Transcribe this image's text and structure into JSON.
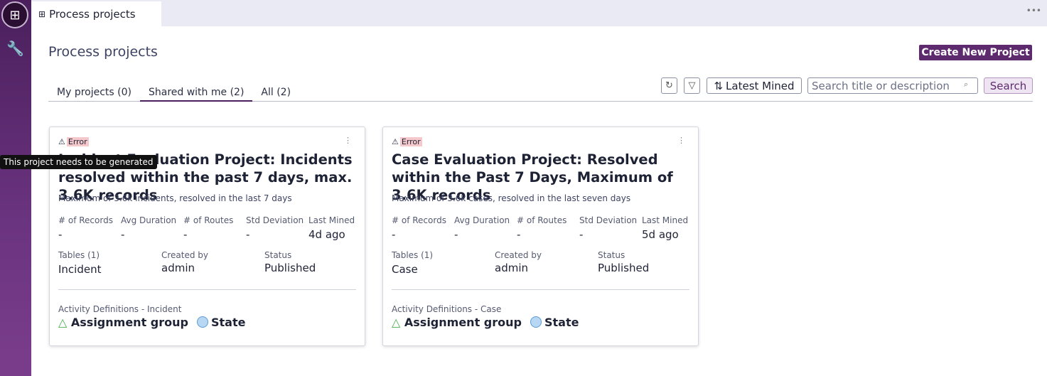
{
  "app": {
    "tab_label": "Process projects",
    "page_title": "Process projects",
    "create_label": "Create New Project"
  },
  "tabs": [
    "My projects (0)",
    "Shared with me (2)",
    "All (2)"
  ],
  "toolbar": {
    "sort_label": "Latest Mined",
    "search_placeholder": "Search title or description",
    "search_label": "Search"
  },
  "tooltip": "This project needs to be generated",
  "labels": {
    "records": "# of Records",
    "avg": "Avg Duration",
    "routes": "# of Routes",
    "std": "Std Deviation",
    "mined": "Last Mined",
    "created": "Created by",
    "status": "Status"
  },
  "cards": [
    {
      "badge": "Error",
      "title": "Incident Evaluation Project: Incidents resolved within the past 7 days, max. 3.6K records",
      "description": "Maximum of 3.6k incidents, resolved in the last 7 days",
      "records": "-",
      "avg": "-",
      "routes": "-",
      "std": "-",
      "mined": "4d ago",
      "tables_label": "Tables (1)",
      "table": "Incident",
      "created": "admin",
      "status": "Published",
      "activity_label": "Activity Definitions - Incident",
      "activities": [
        "Assignment group",
        "State"
      ]
    },
    {
      "badge": "Error",
      "title": "Case Evaluation Project: Resolved within the Past 7 Days, Maximum of 3.6K records",
      "description": "Maximum of 3.6k cases, resolved in the last seven days",
      "records": "-",
      "avg": "-",
      "routes": "-",
      "std": "-",
      "mined": "5d ago",
      "tables_label": "Tables (1)",
      "table": "Case",
      "created": "admin",
      "status": "Published",
      "activity_label": "Activity Definitions - Case",
      "activities": [
        "Assignment group",
        "State"
      ]
    }
  ]
}
